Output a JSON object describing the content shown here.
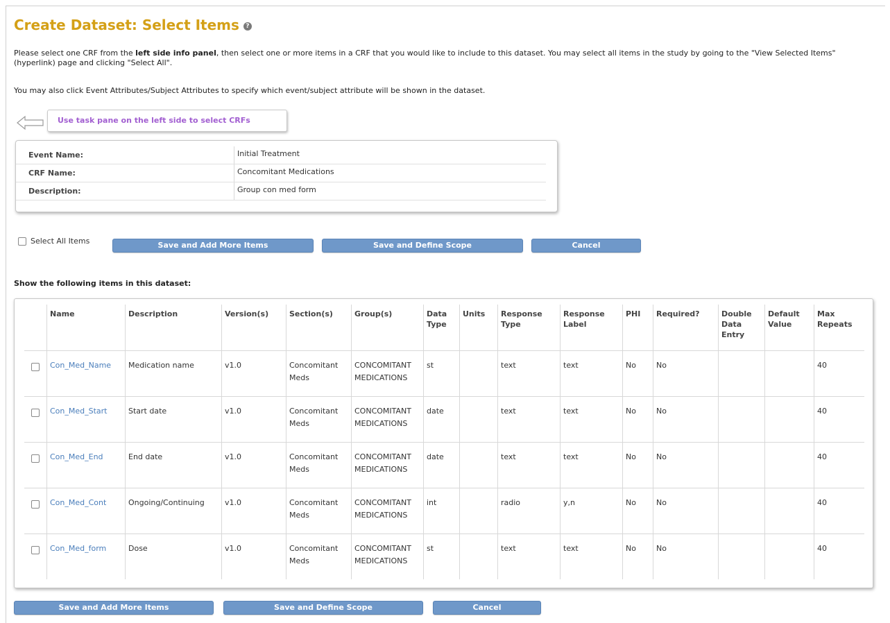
{
  "page": {
    "title": "Create Dataset: Select Items",
    "intro_part1": "Please select one CRF from the ",
    "intro_bold": "left side info panel",
    "intro_part2": ", then select one or more items in a CRF that you would like to include to this dataset. You may select all items in the study by going to the \"View Selected Items\" (hyperlink) page and clicking \"Select All\".",
    "intro2": "You may also click Event Attributes/Subject Attributes to specify which event/subject attribute will be shown in the dataset.",
    "task_pane_text": "Use task pane on the left side to select CRFs"
  },
  "info": [
    {
      "label": "Event Name:",
      "value": "Initial Treatment"
    },
    {
      "label": "CRF Name:",
      "value": "Concomitant Medications"
    },
    {
      "label": "Description:",
      "value": "Group con med form"
    }
  ],
  "actions": {
    "select_all_label": "Select All Items",
    "save_add_more": "Save and Add More Items",
    "save_define_scope": "Save and Define Scope",
    "cancel": "Cancel"
  },
  "items_section_title": "Show the following items in this dataset:",
  "table": {
    "headers": [
      "Name",
      "Description",
      "Version(s)",
      "Section(s)",
      "Group(s)",
      "Data Type",
      "Units",
      "Response Type",
      "Response Label",
      "PHI",
      "Required?",
      "Double Data Entry",
      "Default Value",
      "Max Repeats"
    ],
    "rows": [
      [
        "Con_Med_Name",
        "Medication name",
        "v1.0",
        "Concomitant Meds",
        "CONCOMITANT MEDICATIONS",
        "st",
        "",
        "text",
        "text",
        "No",
        "No",
        "",
        "",
        "40"
      ],
      [
        "Con_Med_Start",
        "Start date",
        "v1.0",
        "Concomitant Meds",
        "CONCOMITANT MEDICATIONS",
        "date",
        "",
        "text",
        "text",
        "No",
        "No",
        "",
        "",
        "40"
      ],
      [
        "Con_Med_End",
        "End date",
        "v1.0",
        "Concomitant Meds",
        "CONCOMITANT MEDICATIONS",
        "date",
        "",
        "text",
        "text",
        "No",
        "No",
        "",
        "",
        "40"
      ],
      [
        "Con_Med_Cont",
        "Ongoing/Continuing",
        "v1.0",
        "Concomitant Meds",
        "CONCOMITANT MEDICATIONS",
        "int",
        "",
        "radio",
        "y,n",
        "No",
        "No",
        "",
        "",
        "40"
      ],
      [
        "Con_Med_form",
        "Dose",
        "v1.0",
        "Concomitant Meds",
        "CONCOMITANT MEDICATIONS",
        "st",
        "",
        "text",
        "text",
        "No",
        "No",
        "",
        "",
        "40"
      ]
    ]
  },
  "icons": {
    "help": "help-circle-icon",
    "arrow": "arrow-left-icon"
  }
}
